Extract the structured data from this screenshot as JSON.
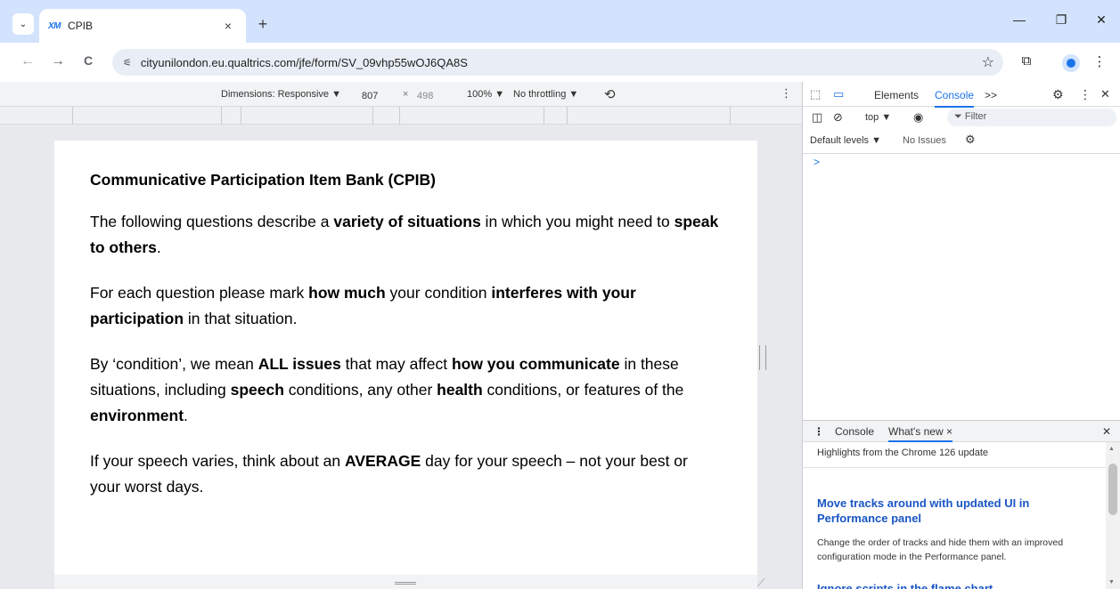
{
  "browser": {
    "tab": {
      "favicon": "XM",
      "title": "CPIB"
    },
    "url": "cityunilondon.eu.qualtrics.com/jfe/form/SV_09vhp55wOJ6QA8S",
    "icons": {
      "tab_dropdown": "⌄",
      "tab_close": "×",
      "new_tab": "+",
      "back": "←",
      "forward": "→",
      "reload": "C",
      "site_info": "⚟",
      "bookmark": "☆",
      "extensions": "⧉",
      "menu": "⋮",
      "minimize": "—",
      "restore": "❐",
      "window_close": "✕"
    }
  },
  "device_toolbar": {
    "dimensions_label": "Dimensions: Responsive ▼",
    "width": "807",
    "times": "×",
    "height": "498",
    "zoom": "100% ▼",
    "throttling": "No throttling ▼",
    "rotate_icon": "⟲",
    "more_icon": "⋮"
  },
  "survey": {
    "title": "Communicative Participation Item Bank (CPIB)",
    "p1": {
      "a": "The following questions describe a ",
      "b1": "variety of situations",
      "c": " in which you might need to ",
      "b2": "speak to others",
      "d": "."
    },
    "p2": {
      "a": "For each question please mark ",
      "b1": "how much",
      "c": " your condition ",
      "b2": "interferes with your participation",
      "d": " in that situation."
    },
    "p3": {
      "a": "By ‘condition’, we mean ",
      "b1": "ALL issues",
      "c": " that may affect ",
      "b2": "how you communicate",
      "d": " in these situations, including ",
      "b3": "speech",
      "e": " conditions, any other ",
      "b4": "health",
      "f": " conditions, or features of the ",
      "b5": "environment",
      "g": "."
    },
    "p4": {
      "a": "If your speech varies, think about an ",
      "b1": "AVERAGE",
      "c": " day for your speech – not your best or your worst days."
    }
  },
  "devtools": {
    "tabs": {
      "elements": "Elements",
      "console": "Console",
      "more": ">>"
    },
    "icons": {
      "inspect": "⬚",
      "device": "▭",
      "settings": "⚙",
      "kebab": "⋮",
      "close": "✕",
      "sidebar": "◫",
      "clear": "⊘",
      "eye": "◉"
    },
    "context": "top ▼",
    "filter": "Filter",
    "levels": "Default levels ▼",
    "issues": "No Issues",
    "prompt": ">",
    "drawer": {
      "tab_console": "Console",
      "tab_whats_new": "What's new",
      "highlights": "Highlights from the Chrome 126 update",
      "item1_title": "Move tracks around with updated UI in Performance panel",
      "item1_desc": "Change the order of tracks and hide them with an improved configuration mode in the Performance panel.",
      "item2_title": "Ignore scripts in the flame chart"
    }
  }
}
